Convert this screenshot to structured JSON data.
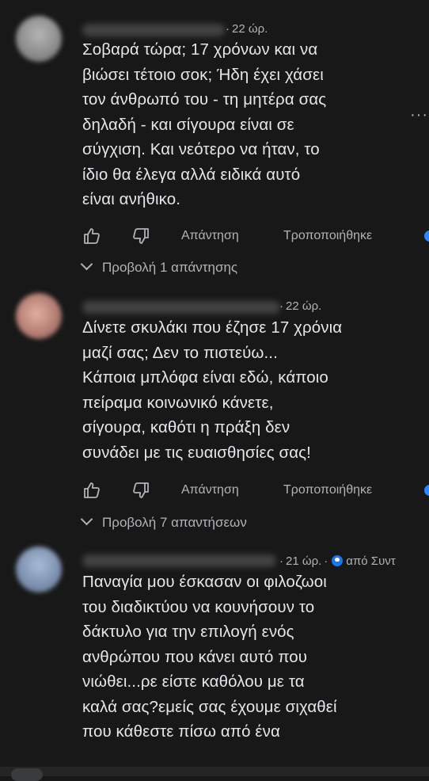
{
  "colors": {
    "background": "#181818",
    "text": "#e4e6eb",
    "muted": "#b0b3b8",
    "accent": "#2d88ff"
  },
  "comments": [
    {
      "time": "22 ώρ.",
      "text": "Σοβαρά τώρα; 17 χρόνων και να\nβιώσει τέτοιο σοκ; Ήδη έχει χάσει\nτον άνθρωπό του - τη μητέρα σας\nδηλαδή - και σίγουρα είναι σε\nσύγχιση. Και νεότερο να ήταν, το\nίδιο θα έλεγα αλλά ειδικά αυτό\nείναι ανήθικο.",
      "reply_label": "Απάντηση",
      "edited_label": "Τροποποιήθηκε",
      "view_replies": "Προβολή 1 απάντησης",
      "avatar_color": "#9a9a9a",
      "more_icon": "more-horizontal-icon"
    },
    {
      "time": "22 ώρ.",
      "text": "Δίνετε σκυλάκι που έζησε 17 χρόνια\nμαζί σας; Δεν το πιστεύω...\nΚάποια μπλόφα είναι εδώ, κάποιο\nπείραμα κοινωνικό κάνετε,\nσίγουρα, καθότι η πράξη δεν\nσυνάδει με τις ευαισθησίες σας!",
      "reply_label": "Απάντηση",
      "edited_label": "Τροποποιήθηκε",
      "view_replies": "Προβολή 7 απαντήσεων",
      "avatar_color": "#c99085"
    },
    {
      "time": "21 ώρ.",
      "source": "από Συντ",
      "text": "Παναγία μου έσκασαν οι φιλοζωοι\nτου διαδικτύου να κουνήσουν το\nδάκτυλο για την επιλογή ενός\nανθρώπου που κάνει αυτό που\nνιώθει...ρε είστε καθόλου με τα\nκαλά σας?εμείς σας έχουμε σιχαθεί\nπου κάθεστε πίσω από ένα",
      "avatar_color": "#8fa3bf",
      "source_icon": "globe-icon"
    }
  ],
  "icons": {
    "like": "thumbs-up-icon",
    "dislike": "thumbs-down-icon",
    "expand": "chevron-down-icon"
  }
}
